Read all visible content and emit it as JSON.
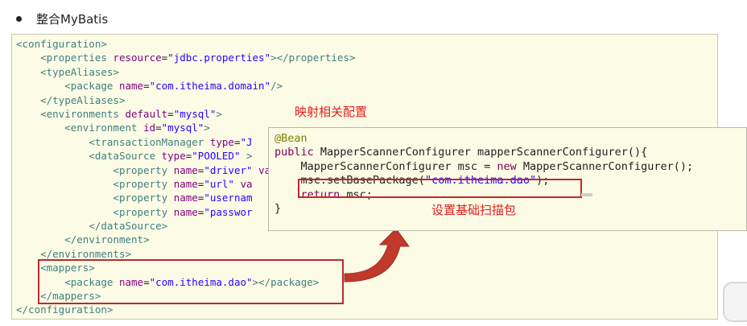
{
  "heading": {
    "text": "整合MyBatis"
  },
  "xml_lines": [
    [
      [
        "t",
        "<configuration>"
      ]
    ],
    [
      [
        "p",
        "    "
      ],
      [
        "t",
        "<properties "
      ],
      [
        "a",
        "resource"
      ],
      [
        "p",
        "="
      ],
      [
        "v",
        "\"jdbc.properties\""
      ],
      [
        "t",
        "></properties>"
      ]
    ],
    [
      [
        "p",
        "    "
      ],
      [
        "t",
        "<typeAliases>"
      ]
    ],
    [
      [
        "p",
        "        "
      ],
      [
        "t",
        "<package "
      ],
      [
        "a",
        "name"
      ],
      [
        "p",
        "="
      ],
      [
        "v",
        "\"com.itheima.domain\""
      ],
      [
        "t",
        "/>"
      ]
    ],
    [
      [
        "p",
        "    "
      ],
      [
        "t",
        "</typeAliases>"
      ]
    ],
    [
      [
        "p",
        "    "
      ],
      [
        "t",
        "<environments "
      ],
      [
        "a",
        "default"
      ],
      [
        "p",
        "="
      ],
      [
        "v",
        "\"mysql\""
      ],
      [
        "t",
        ">"
      ]
    ],
    [
      [
        "p",
        "        "
      ],
      [
        "t",
        "<environment "
      ],
      [
        "a",
        "id"
      ],
      [
        "p",
        "="
      ],
      [
        "v",
        "\"mysql\""
      ],
      [
        "t",
        ">"
      ]
    ],
    [
      [
        "p",
        "            "
      ],
      [
        "t",
        "<transactionManager "
      ],
      [
        "a",
        "type"
      ],
      [
        "p",
        "="
      ],
      [
        "v",
        "\"J"
      ]
    ],
    [
      [
        "p",
        "            "
      ],
      [
        "t",
        "<dataSource "
      ],
      [
        "a",
        "type"
      ],
      [
        "p",
        "="
      ],
      [
        "v",
        "\"POOLED\""
      ],
      [
        "t",
        " >"
      ]
    ],
    [
      [
        "p",
        "                "
      ],
      [
        "t",
        "<property "
      ],
      [
        "a",
        "name"
      ],
      [
        "p",
        "="
      ],
      [
        "v",
        "\"driver\""
      ],
      [
        "p",
        " "
      ],
      [
        "a",
        "va"
      ]
    ],
    [
      [
        "p",
        "                "
      ],
      [
        "t",
        "<property "
      ],
      [
        "a",
        "name"
      ],
      [
        "p",
        "="
      ],
      [
        "v",
        "\"url\""
      ],
      [
        "p",
        " "
      ],
      [
        "a",
        "va"
      ]
    ],
    [
      [
        "p",
        "                "
      ],
      [
        "t",
        "<property "
      ],
      [
        "a",
        "name"
      ],
      [
        "p",
        "="
      ],
      [
        "v",
        "\"usernam"
      ]
    ],
    [
      [
        "p",
        "                "
      ],
      [
        "t",
        "<property "
      ],
      [
        "a",
        "name"
      ],
      [
        "p",
        "="
      ],
      [
        "v",
        "\"passwor"
      ]
    ],
    [
      [
        "p",
        "            "
      ],
      [
        "t",
        "</dataSource>"
      ]
    ],
    [
      [
        "p",
        "        "
      ],
      [
        "t",
        "</environment>"
      ]
    ],
    [
      [
        "p",
        "    "
      ],
      [
        "t",
        "</environments>"
      ]
    ],
    [
      [
        "p",
        "    "
      ],
      [
        "t",
        "<mappers>"
      ]
    ],
    [
      [
        "p",
        "        "
      ],
      [
        "t",
        "<package "
      ],
      [
        "a",
        "name"
      ],
      [
        "p",
        "="
      ],
      [
        "v",
        "\"com.itheima.dao\""
      ],
      [
        "t",
        "></package>"
      ]
    ],
    [
      [
        "p",
        "    "
      ],
      [
        "t",
        "</mappers>"
      ]
    ],
    [
      [
        "t",
        "</configuration>"
      ]
    ]
  ],
  "java_lines": [
    [
      [
        "ann",
        "@Bean"
      ]
    ],
    [
      [
        "kw",
        "public "
      ],
      [
        "p",
        "MapperScannerConfigurer mapperScannerConfigurer(){"
      ]
    ],
    [
      [
        "p",
        "    MapperScannerConfigurer msc = "
      ],
      [
        "kw",
        "new "
      ],
      [
        "p",
        "MapperScannerConfigurer();"
      ]
    ],
    [
      [
        "p",
        "    msc.setBasePackage("
      ],
      [
        "str",
        "\"com.itheima.dao\""
      ],
      [
        "p",
        ");"
      ]
    ],
    [
      [
        "p",
        "    "
      ],
      [
        "kw",
        "return "
      ],
      [
        "p",
        "msc;"
      ]
    ],
    [
      [
        "p",
        "}"
      ]
    ]
  ],
  "annotations": {
    "mapping_config": "映射相关配置",
    "set_base_package": "设置基础扫描包"
  },
  "colors": {
    "highlight_border": "#c0272d",
    "annotation_text": "#e02020",
    "arrow_fill": "#c0392b",
    "panel_background": "#fbfbe6"
  }
}
